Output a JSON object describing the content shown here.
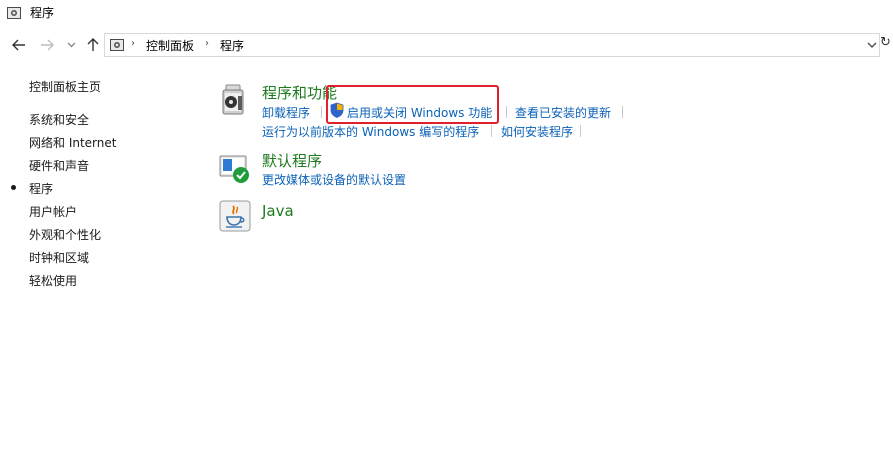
{
  "window": {
    "title": "程序"
  },
  "nav": {
    "back_icon": "arrow-left-icon",
    "forward_icon": "arrow-right-icon",
    "recent_icon": "chevron-down-icon",
    "up_icon": "arrow-up-icon",
    "breadcrumbs": [
      "控制面板",
      "程序"
    ],
    "refresh_icon": "refresh-icon"
  },
  "sidebar": {
    "items": [
      {
        "label": "控制面板主页",
        "active": false
      },
      {
        "label": "系统和安全",
        "active": false
      },
      {
        "label": "网络和 Internet",
        "active": false
      },
      {
        "label": "硬件和声音",
        "active": false
      },
      {
        "label": "程序",
        "active": true
      },
      {
        "label": "用户帐户",
        "active": false
      },
      {
        "label": "外观和个性化",
        "active": false
      },
      {
        "label": "时钟和区域",
        "active": false
      },
      {
        "label": "轻松使用",
        "active": false
      }
    ]
  },
  "categories": [
    {
      "title": "程序和功能",
      "icon": "programs-features-icon",
      "links": [
        "卸载程序",
        "启用或关闭 Windows 功能",
        "查看已安装的更新",
        "运行为以前版本的 Windows 编写的程序",
        "如何安装程序"
      ]
    },
    {
      "title": "默认程序",
      "icon": "default-programs-icon",
      "links": [
        "更改媒体或设备的默认设置"
      ]
    },
    {
      "title": "Java",
      "icon": "java-icon",
      "links": []
    }
  ],
  "colors": {
    "category_title": "#1e7a1e",
    "link": "#0b62b8",
    "highlight_box": "#e0202a"
  }
}
